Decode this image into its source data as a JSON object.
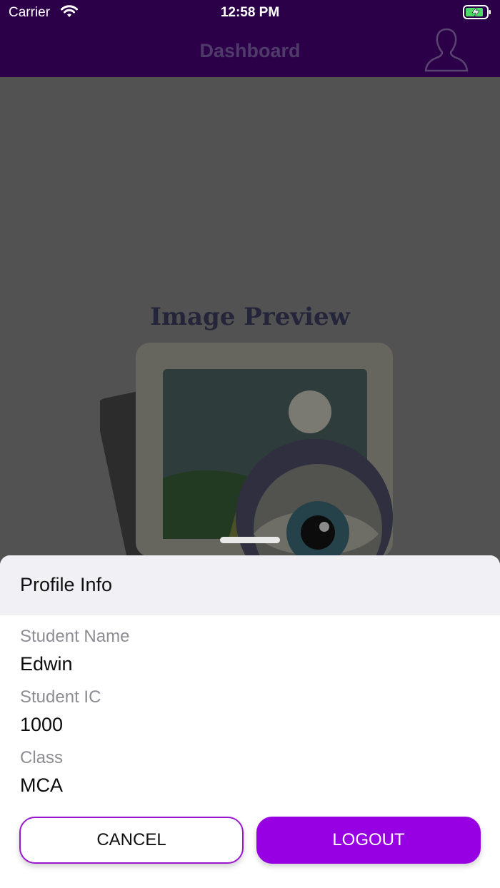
{
  "status_bar": {
    "carrier": "Carrier",
    "time": "12:58 PM"
  },
  "nav": {
    "title": "Dashboard"
  },
  "preview": {
    "title": "Image Preview"
  },
  "sheet": {
    "title": "Profile Info",
    "fields": [
      {
        "label": "Student Name",
        "value": "Edwin"
      },
      {
        "label": "Student IC",
        "value": "1000"
      },
      {
        "label": "Class",
        "value": "MCA"
      }
    ],
    "cancel_label": "CANCEL",
    "logout_label": "LOGOUT"
  },
  "colors": {
    "nav_bg": "#2c0048",
    "accent": "#9800e4",
    "overlay": "#525252"
  },
  "icons": {
    "wifi": "wifi-icon",
    "battery": "battery-charging-icon",
    "profile": "user-silhouette-icon"
  }
}
